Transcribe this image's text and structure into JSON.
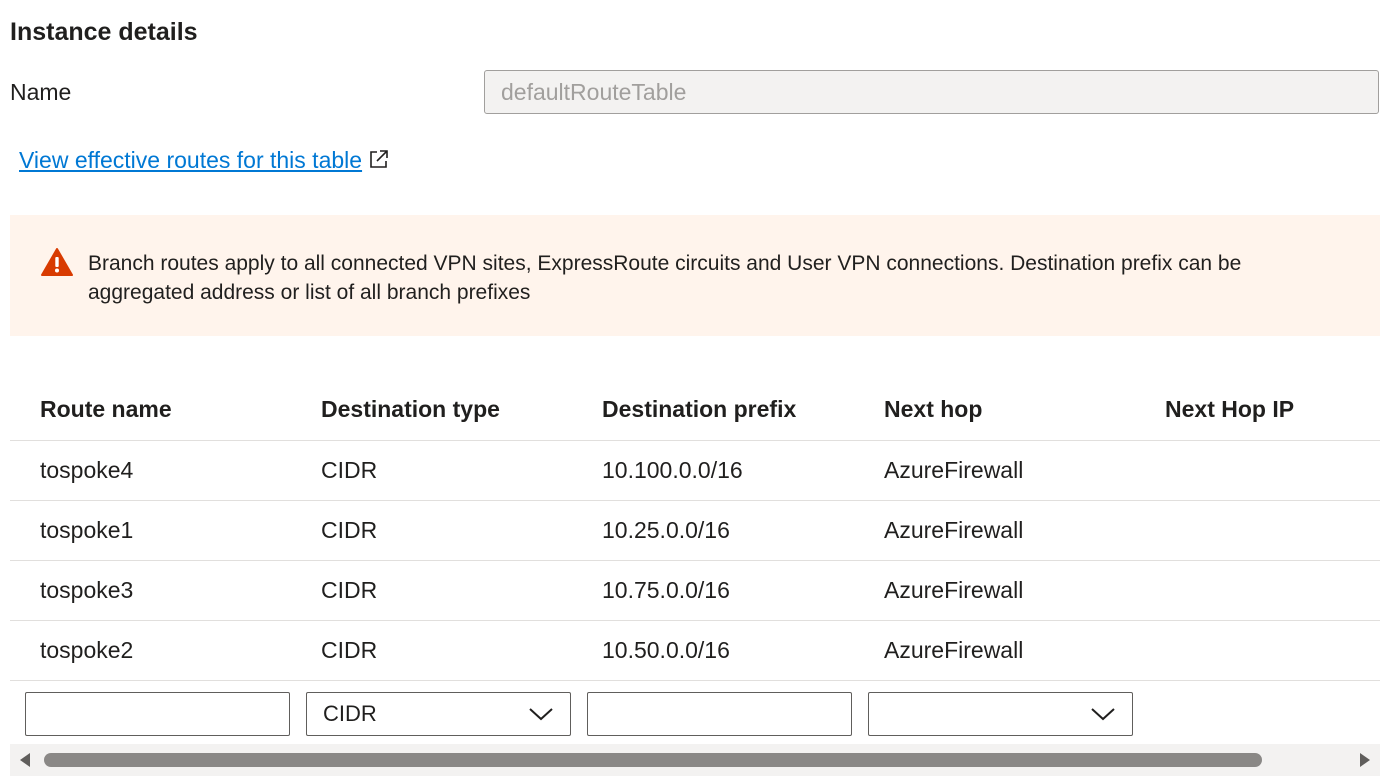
{
  "section": {
    "title": "Instance details"
  },
  "name_field": {
    "label": "Name",
    "value": "defaultRouteTable"
  },
  "effective_routes_link": {
    "label": "View effective routes for this table",
    "icon": "external-link-icon"
  },
  "warning": {
    "icon": "warning-icon",
    "text": "Branch routes apply to all connected VPN sites, ExpressRoute circuits and User VPN connections. Destination prefix can be aggregated address or list of all branch prefixes"
  },
  "table": {
    "columns": [
      "Route name",
      "Destination type",
      "Destination prefix",
      "Next hop",
      "Next Hop IP"
    ],
    "rows": [
      {
        "name": "tospoke4",
        "type": "CIDR",
        "prefix": "10.100.0.0/16",
        "next_hop": "AzureFirewall",
        "next_hop_ip": ""
      },
      {
        "name": "tospoke1",
        "type": "CIDR",
        "prefix": "10.25.0.0/16",
        "next_hop": "AzureFirewall",
        "next_hop_ip": ""
      },
      {
        "name": "tospoke3",
        "type": "CIDR",
        "prefix": "10.75.0.0/16",
        "next_hop": "AzureFirewall",
        "next_hop_ip": ""
      },
      {
        "name": "tospoke2",
        "type": "CIDR",
        "prefix": "10.50.0.0/16",
        "next_hop": "AzureFirewall",
        "next_hop_ip": ""
      }
    ]
  },
  "new_route": {
    "name_value": "",
    "type_selected": "CIDR",
    "prefix_value": "",
    "next_hop_selected": ""
  },
  "colors": {
    "link": "#0078d4",
    "warning_bg": "#fff4ec",
    "warning_icon": "#d83b01",
    "border": "#e1dfdd"
  }
}
